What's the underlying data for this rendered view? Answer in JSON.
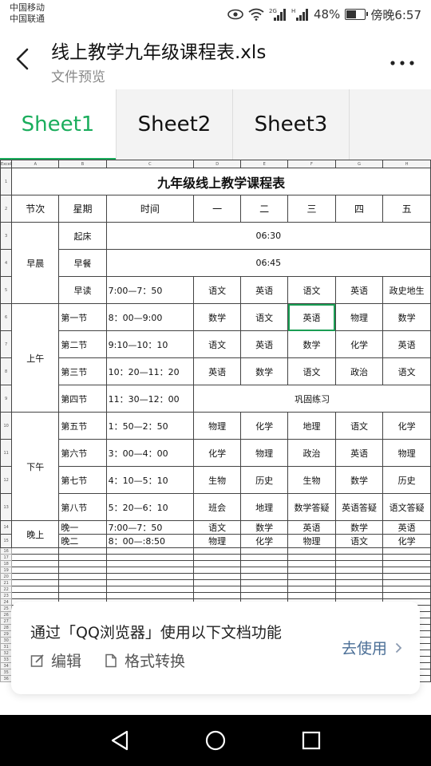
{
  "status": {
    "carrier1": "中国移动",
    "carrier2": "中国联通",
    "battery_pct": "48%",
    "time": "傍晚6:57"
  },
  "header": {
    "title": "线上教学九年级课程表.xls",
    "subtitle": "文件预览"
  },
  "tabs": [
    {
      "label": "Sheet1",
      "active": true
    },
    {
      "label": "Sheet2",
      "active": false
    },
    {
      "label": "Sheet3",
      "active": false
    }
  ],
  "sheet": {
    "corner": "Excel",
    "col_letters": [
      "A",
      "B",
      "C",
      "D",
      "E",
      "F",
      "G",
      "H"
    ],
    "title": "九年级线上教学课程表",
    "headers": [
      "节次",
      "星期",
      "时间",
      "一",
      "二",
      "三",
      "四",
      "五"
    ],
    "morning": {
      "label": "早晨",
      "getup": {
        "name": "起床",
        "time": "06:30"
      },
      "breakfast": {
        "name": "早餐",
        "time": "06:45"
      },
      "reading": {
        "name": "早读",
        "time": "7:00—7：50",
        "subjects": [
          "语文",
          "英语",
          "语文",
          "英语",
          "政史地生"
        ]
      }
    },
    "am": {
      "label": "上午",
      "p1": {
        "name": "第一节",
        "time": "8：00—9:00",
        "subjects": [
          "数学",
          "语文",
          "英语",
          "物理",
          "数学"
        ]
      },
      "p2": {
        "name": "第二节",
        "time": "9:10—10：10",
        "subjects": [
          "语文",
          "英语",
          "数学",
          "化学",
          "英语"
        ]
      },
      "p3": {
        "name": "第三节",
        "time": "10：20—11：20",
        "subjects": [
          "英语",
          "数学",
          "语文",
          "政治",
          "语文"
        ]
      },
      "p4": {
        "name": "第四节",
        "time": "11：30—12：00",
        "merged": "巩固练习"
      }
    },
    "pm": {
      "label": "下午",
      "p5": {
        "name": "第五节",
        "time": "1：50—2：50",
        "subjects": [
          "物理",
          "化学",
          "地理",
          "语文",
          "化学"
        ]
      },
      "p6": {
        "name": "第六节",
        "time": "3：00—4：00",
        "subjects": [
          "化学",
          "物理",
          "政治",
          "英语",
          "物理"
        ]
      },
      "p7": {
        "name": "第七节",
        "time": "4：10—5：10",
        "subjects": [
          "生物",
          "历史",
          "生物",
          "数学",
          "历史"
        ]
      },
      "p8": {
        "name": "第八节",
        "time": "5：20—6：10",
        "subjects": [
          "班会",
          "地理",
          "数学答疑",
          "英语答疑",
          "语文答疑"
        ]
      }
    },
    "eve": {
      "label": "晚上",
      "e1": {
        "name": "晚一",
        "time": "7:00—7：50",
        "subjects": [
          "语文",
          "数学",
          "英语",
          "数学",
          "英语"
        ]
      },
      "e2": {
        "name": "晚二",
        "time": "8：00—:8:50",
        "subjects": [
          "物理",
          "化学",
          "物理",
          "语文",
          "化学"
        ]
      }
    },
    "row_nums": [
      "1",
      "2",
      "3",
      "4",
      "5",
      "6",
      "7",
      "8",
      "9",
      "10",
      "11",
      "12",
      "13",
      "14",
      "15",
      "16",
      "17",
      "18",
      "19",
      "20",
      "21",
      "22",
      "23",
      "24",
      "25",
      "26",
      "27",
      "28",
      "29",
      "30",
      "31",
      "32",
      "33",
      "34",
      "35",
      "36"
    ]
  },
  "popup": {
    "title": "通过「QQ浏览器」使用以下文档功能",
    "edit": "编辑",
    "convert": "格式转换",
    "go": "去使用"
  }
}
